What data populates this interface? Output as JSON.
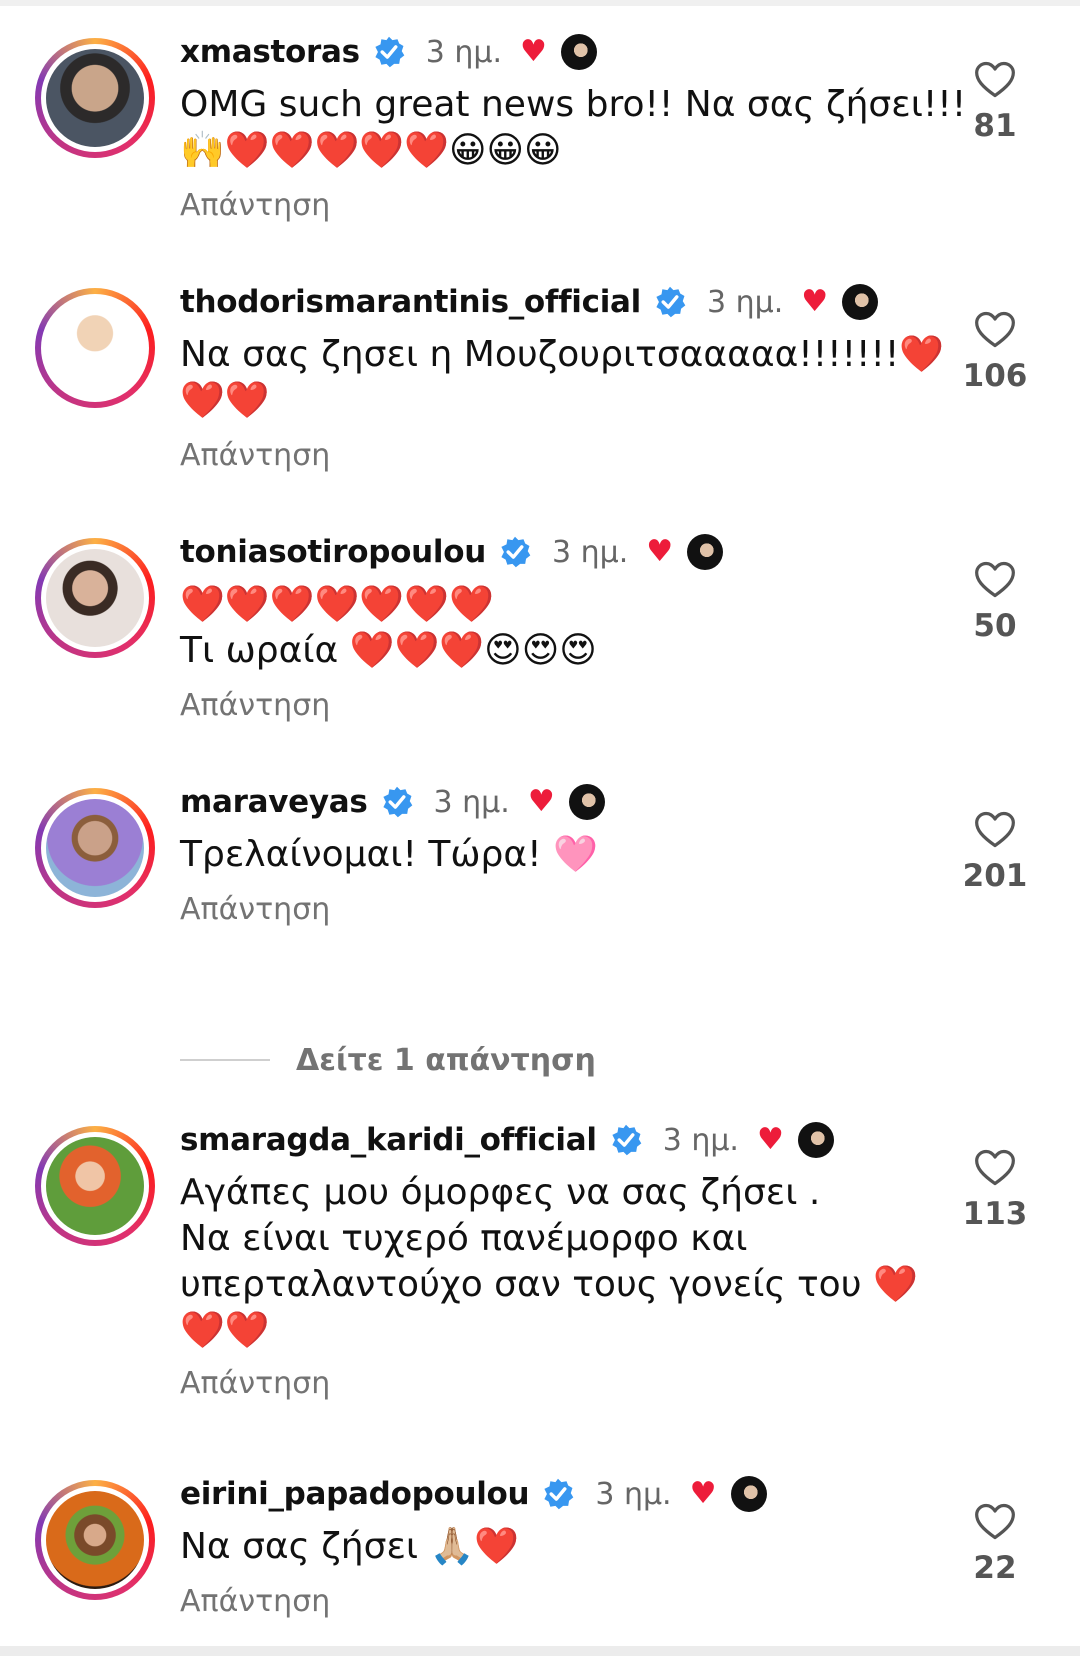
{
  "colors": {
    "like_heart": "#ed1c3a",
    "verified": "#3897f0",
    "muted_text": "#737373"
  },
  "view_replies": {
    "label": "Δείτε 1 απάντηση"
  },
  "comments": [
    {
      "username": "xmastoras",
      "time": "3 ημ.",
      "text": "OMG such great news bro!! Να σας ζήσει!!!\n🙌❤️❤️❤️❤️❤️😀😀😀",
      "reply_label": "Απάντηση",
      "likes": "81",
      "creator_liked": true,
      "verified": true
    },
    {
      "username": "thodorismarantinis_official",
      "time": "3 ημ.",
      "text": "Να σας ζησει η Μουζουριτσααααα!!!!!!!❤️\n❤️❤️",
      "reply_label": "Απάντηση",
      "likes": "106",
      "creator_liked": true,
      "verified": true
    },
    {
      "username": "toniasotiropoulou",
      "time": "3 ημ.",
      "text": "❤️❤️❤️❤️❤️❤️❤️\nΤι ωραία ❤️❤️❤️😍😍😍",
      "reply_label": "Απάντηση",
      "likes": "50",
      "creator_liked": true,
      "verified": true
    },
    {
      "username": "maraveyas",
      "time": "3 ημ.",
      "text": "Τρελαίνομαι! Τώρα! 🩷",
      "reply_label": "Απάντηση",
      "likes": "201",
      "creator_liked": true,
      "verified": true
    },
    {
      "username": "smaragda_karidi_official",
      "time": "3 ημ.",
      "text": "Αγάπες μου όμορφες να σας ζήσει .\nΝα είναι τυχερό πανέμορφο και\nυπερταλαντούχο σαν τους γονείς του ❤️\n❤️❤️",
      "reply_label": "Απάντηση",
      "likes": "113",
      "creator_liked": true,
      "verified": true
    },
    {
      "username": "eirini_papadopoulou",
      "time": "3 ημ.",
      "text": "Να σας ζήσει 🙏🏼❤️",
      "reply_label": "Απάντηση",
      "likes": "22",
      "creator_liked": true,
      "verified": true
    }
  ]
}
